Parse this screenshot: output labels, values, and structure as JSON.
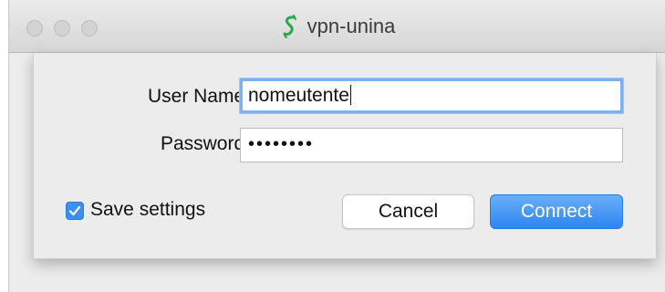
{
  "window": {
    "title": "vpn-unina",
    "app_icon": "vpn-app-icon"
  },
  "form": {
    "username_label": "User Name:",
    "username_value": "nomeutente",
    "password_label": "Password:",
    "password_value": "••••••••",
    "save_settings_label": "Save settings",
    "save_settings_checked": true
  },
  "buttons": {
    "cancel_label": "Cancel",
    "connect_label": "Connect"
  },
  "colors": {
    "accent": "#2d86f1",
    "focus_ring": "#7fb0f0",
    "app_icon_green": "#2aa84a"
  }
}
